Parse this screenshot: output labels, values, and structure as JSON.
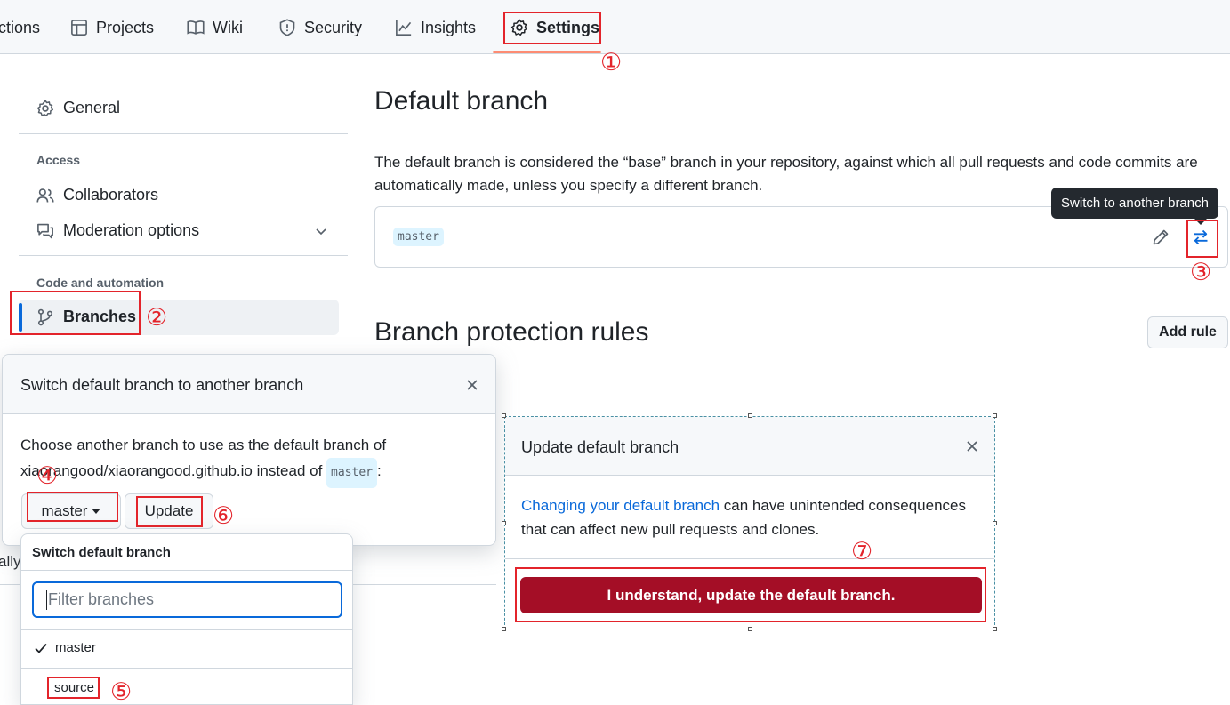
{
  "nav": {
    "tabs": [
      {
        "label": "ctions",
        "icon": "play-icon"
      },
      {
        "label": "Projects",
        "icon": "table-icon"
      },
      {
        "label": "Wiki",
        "icon": "book-icon"
      },
      {
        "label": "Security",
        "icon": "shield-icon"
      },
      {
        "label": "Insights",
        "icon": "graph-icon"
      },
      {
        "label": "Settings",
        "icon": "gear-icon",
        "active": true
      }
    ]
  },
  "sidebar": {
    "general": "General",
    "access_heading": "Access",
    "collaborators": "Collaborators",
    "moderation": "Moderation options",
    "code_heading": "Code and automation",
    "branches": "Branches"
  },
  "main": {
    "default_branch_title": "Default branch",
    "default_branch_desc": "The default branch is considered the “base” branch in your repository, against which all pull requests and code commits are automatically made, unless you specify a different branch.",
    "current_branch": "master",
    "switch_tooltip": "Switch to another branch",
    "protection_title": "Branch protection rules",
    "add_rule": "Add rule"
  },
  "switch_dialog": {
    "title": "Switch default branch to another branch",
    "body_prefix": "Choose another branch to use as the default branch of xiaorangood/xiaorangood.github.io instead of",
    "body_code": "master",
    "body_suffix": ":",
    "select_label": "master",
    "update_label": "Update"
  },
  "dropdown": {
    "header": "Switch default branch",
    "filter_placeholder": "Filter branches",
    "items": [
      "master",
      "source"
    ],
    "selected": "master"
  },
  "update_dialog": {
    "title": "Update default branch",
    "link_text": "Changing your default branch",
    "body_rest": "can have unintended consequences that can affect new pull requests and clones.",
    "confirm_label": "I understand, update the default branch."
  },
  "fragments": {
    "left_text": "ally"
  },
  "annotations": [
    "①",
    "②",
    "③",
    "④",
    "⑤",
    "⑥",
    "⑦"
  ],
  "colors": {
    "annotation_red": "#e3242b",
    "accent_blue": "#0969da",
    "danger": "#a40e26",
    "tab_underline": "#fd8c73"
  }
}
